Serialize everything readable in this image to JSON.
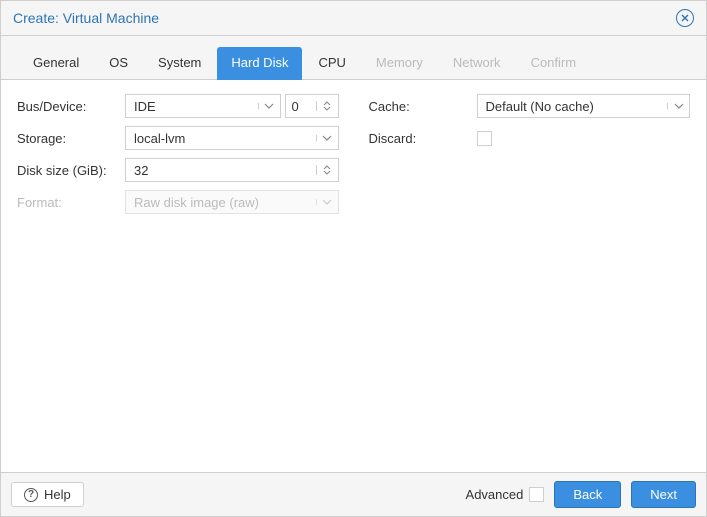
{
  "title": "Create: Virtual Machine",
  "tabs": {
    "general": "General",
    "os": "OS",
    "system": "System",
    "hard_disk": "Hard Disk",
    "cpu": "CPU",
    "memory": "Memory",
    "network": "Network",
    "confirm": "Confirm"
  },
  "left": {
    "bus_device_label": "Bus/Device:",
    "bus_value": "IDE",
    "device_value": "0",
    "storage_label": "Storage:",
    "storage_value": "local-lvm",
    "size_label": "Disk size (GiB):",
    "size_value": "32",
    "format_label": "Format:",
    "format_value": "Raw disk image (raw)"
  },
  "right": {
    "cache_label": "Cache:",
    "cache_value": "Default (No cache)",
    "discard_label": "Discard:"
  },
  "footer": {
    "help": "Help",
    "advanced": "Advanced",
    "back": "Back",
    "next": "Next"
  }
}
